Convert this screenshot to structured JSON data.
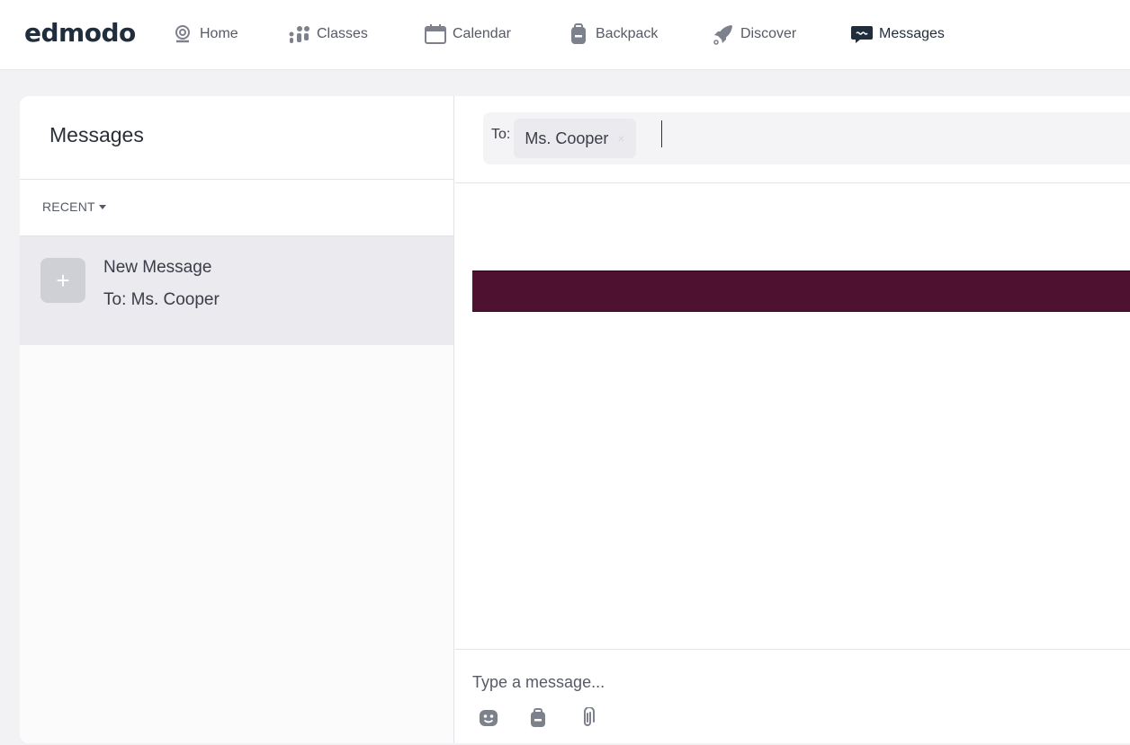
{
  "app": {
    "logo_text": "edmodo"
  },
  "nav": {
    "items": [
      {
        "label": "Home",
        "icon": "home-icon"
      },
      {
        "label": "Classes",
        "icon": "classes-icon"
      },
      {
        "label": "Calendar",
        "icon": "calendar-icon"
      },
      {
        "label": "Backpack",
        "icon": "backpack-icon"
      },
      {
        "label": "Discover",
        "icon": "rocket-icon"
      },
      {
        "label": "Messages",
        "icon": "message-bubble-icon",
        "active": true
      }
    ]
  },
  "sidebar": {
    "title": "Messages",
    "filter_label": "RECENT",
    "conversations": [
      {
        "title": "New Message",
        "subtitle": "To: Ms. Cooper",
        "avatar_glyph": "+"
      }
    ]
  },
  "compose": {
    "to_label": "To:",
    "recipient": "Ms. Cooper",
    "recipient_remove_glyph": "×",
    "message_placeholder": "Type a message...",
    "tools": [
      "emoji-icon",
      "backpack-icon",
      "paperclip-icon"
    ]
  },
  "colors": {
    "banner": "#4e1230",
    "active_row": "#ebebef",
    "logo": "#1f2d3d"
  }
}
